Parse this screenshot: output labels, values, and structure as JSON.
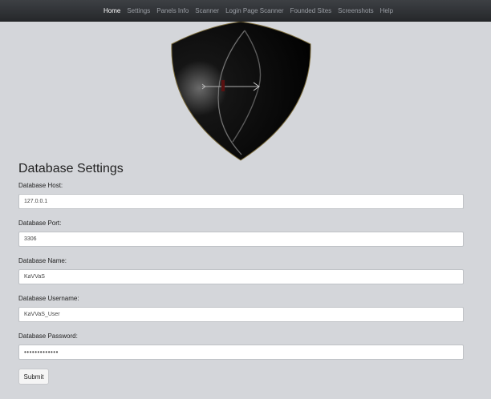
{
  "nav": {
    "items": [
      {
        "label": "Home",
        "active": true
      },
      {
        "label": "Settings"
      },
      {
        "label": "Panels Info"
      },
      {
        "label": "Scanner"
      },
      {
        "label": "Login Page Scanner"
      },
      {
        "label": "Founded Sites"
      },
      {
        "label": "Screenshots"
      },
      {
        "label": "Help"
      }
    ]
  },
  "logo": {
    "icon": "shield-bow-icon"
  },
  "form": {
    "title": "Database Settings",
    "fields": [
      {
        "label": "Database Host:",
        "value": "127.0.0.1"
      },
      {
        "label": "Database Port:",
        "value": "3306"
      },
      {
        "label": "Database Name:",
        "value": "KaVVaS"
      },
      {
        "label": "Database Username:",
        "value": "KaVVaS_User"
      },
      {
        "label": "Database Password:",
        "value": "•••••••••••••"
      }
    ],
    "submit_label": "Submit"
  },
  "colors": {
    "navbar": "#2c2e31",
    "nav_active": "#ffffff",
    "nav_inactive": "#9a9ea4",
    "page_background": "#d4d6da"
  }
}
